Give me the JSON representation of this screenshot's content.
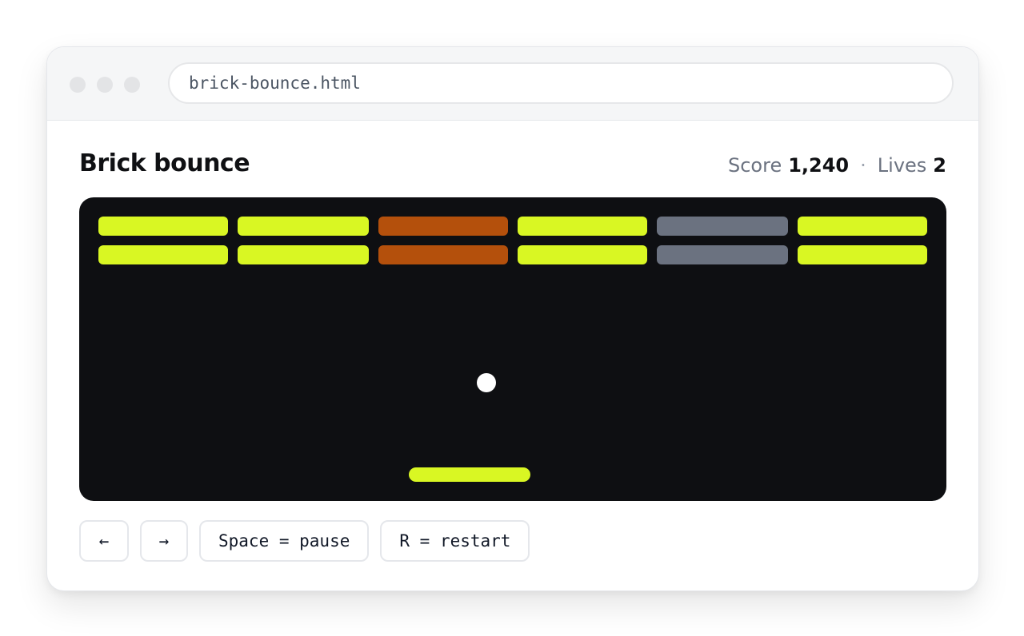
{
  "browser": {
    "url": "brick-bounce.html"
  },
  "game": {
    "title": "Brick bounce",
    "score_label": "Score",
    "score": "1,240",
    "separator": "·",
    "lives_label": "Lives",
    "lives": "2"
  },
  "bricks": {
    "colors": {
      "lime": "#d9f723",
      "orange": "#b4500c",
      "gray": "#6b7280"
    },
    "rows": [
      [
        "lime",
        "lime",
        "orange",
        "lime",
        "gray",
        "lime"
      ],
      [
        "lime",
        "lime",
        "orange",
        "lime",
        "gray",
        "lime"
      ]
    ]
  },
  "controls": {
    "left_key": "←",
    "right_key": "→",
    "pause_hint": "Space = pause",
    "restart_hint": "R = restart"
  },
  "colors": {
    "board_bg": "#0e0f12",
    "accent": "#d9f723",
    "ball": "#ffffff"
  }
}
